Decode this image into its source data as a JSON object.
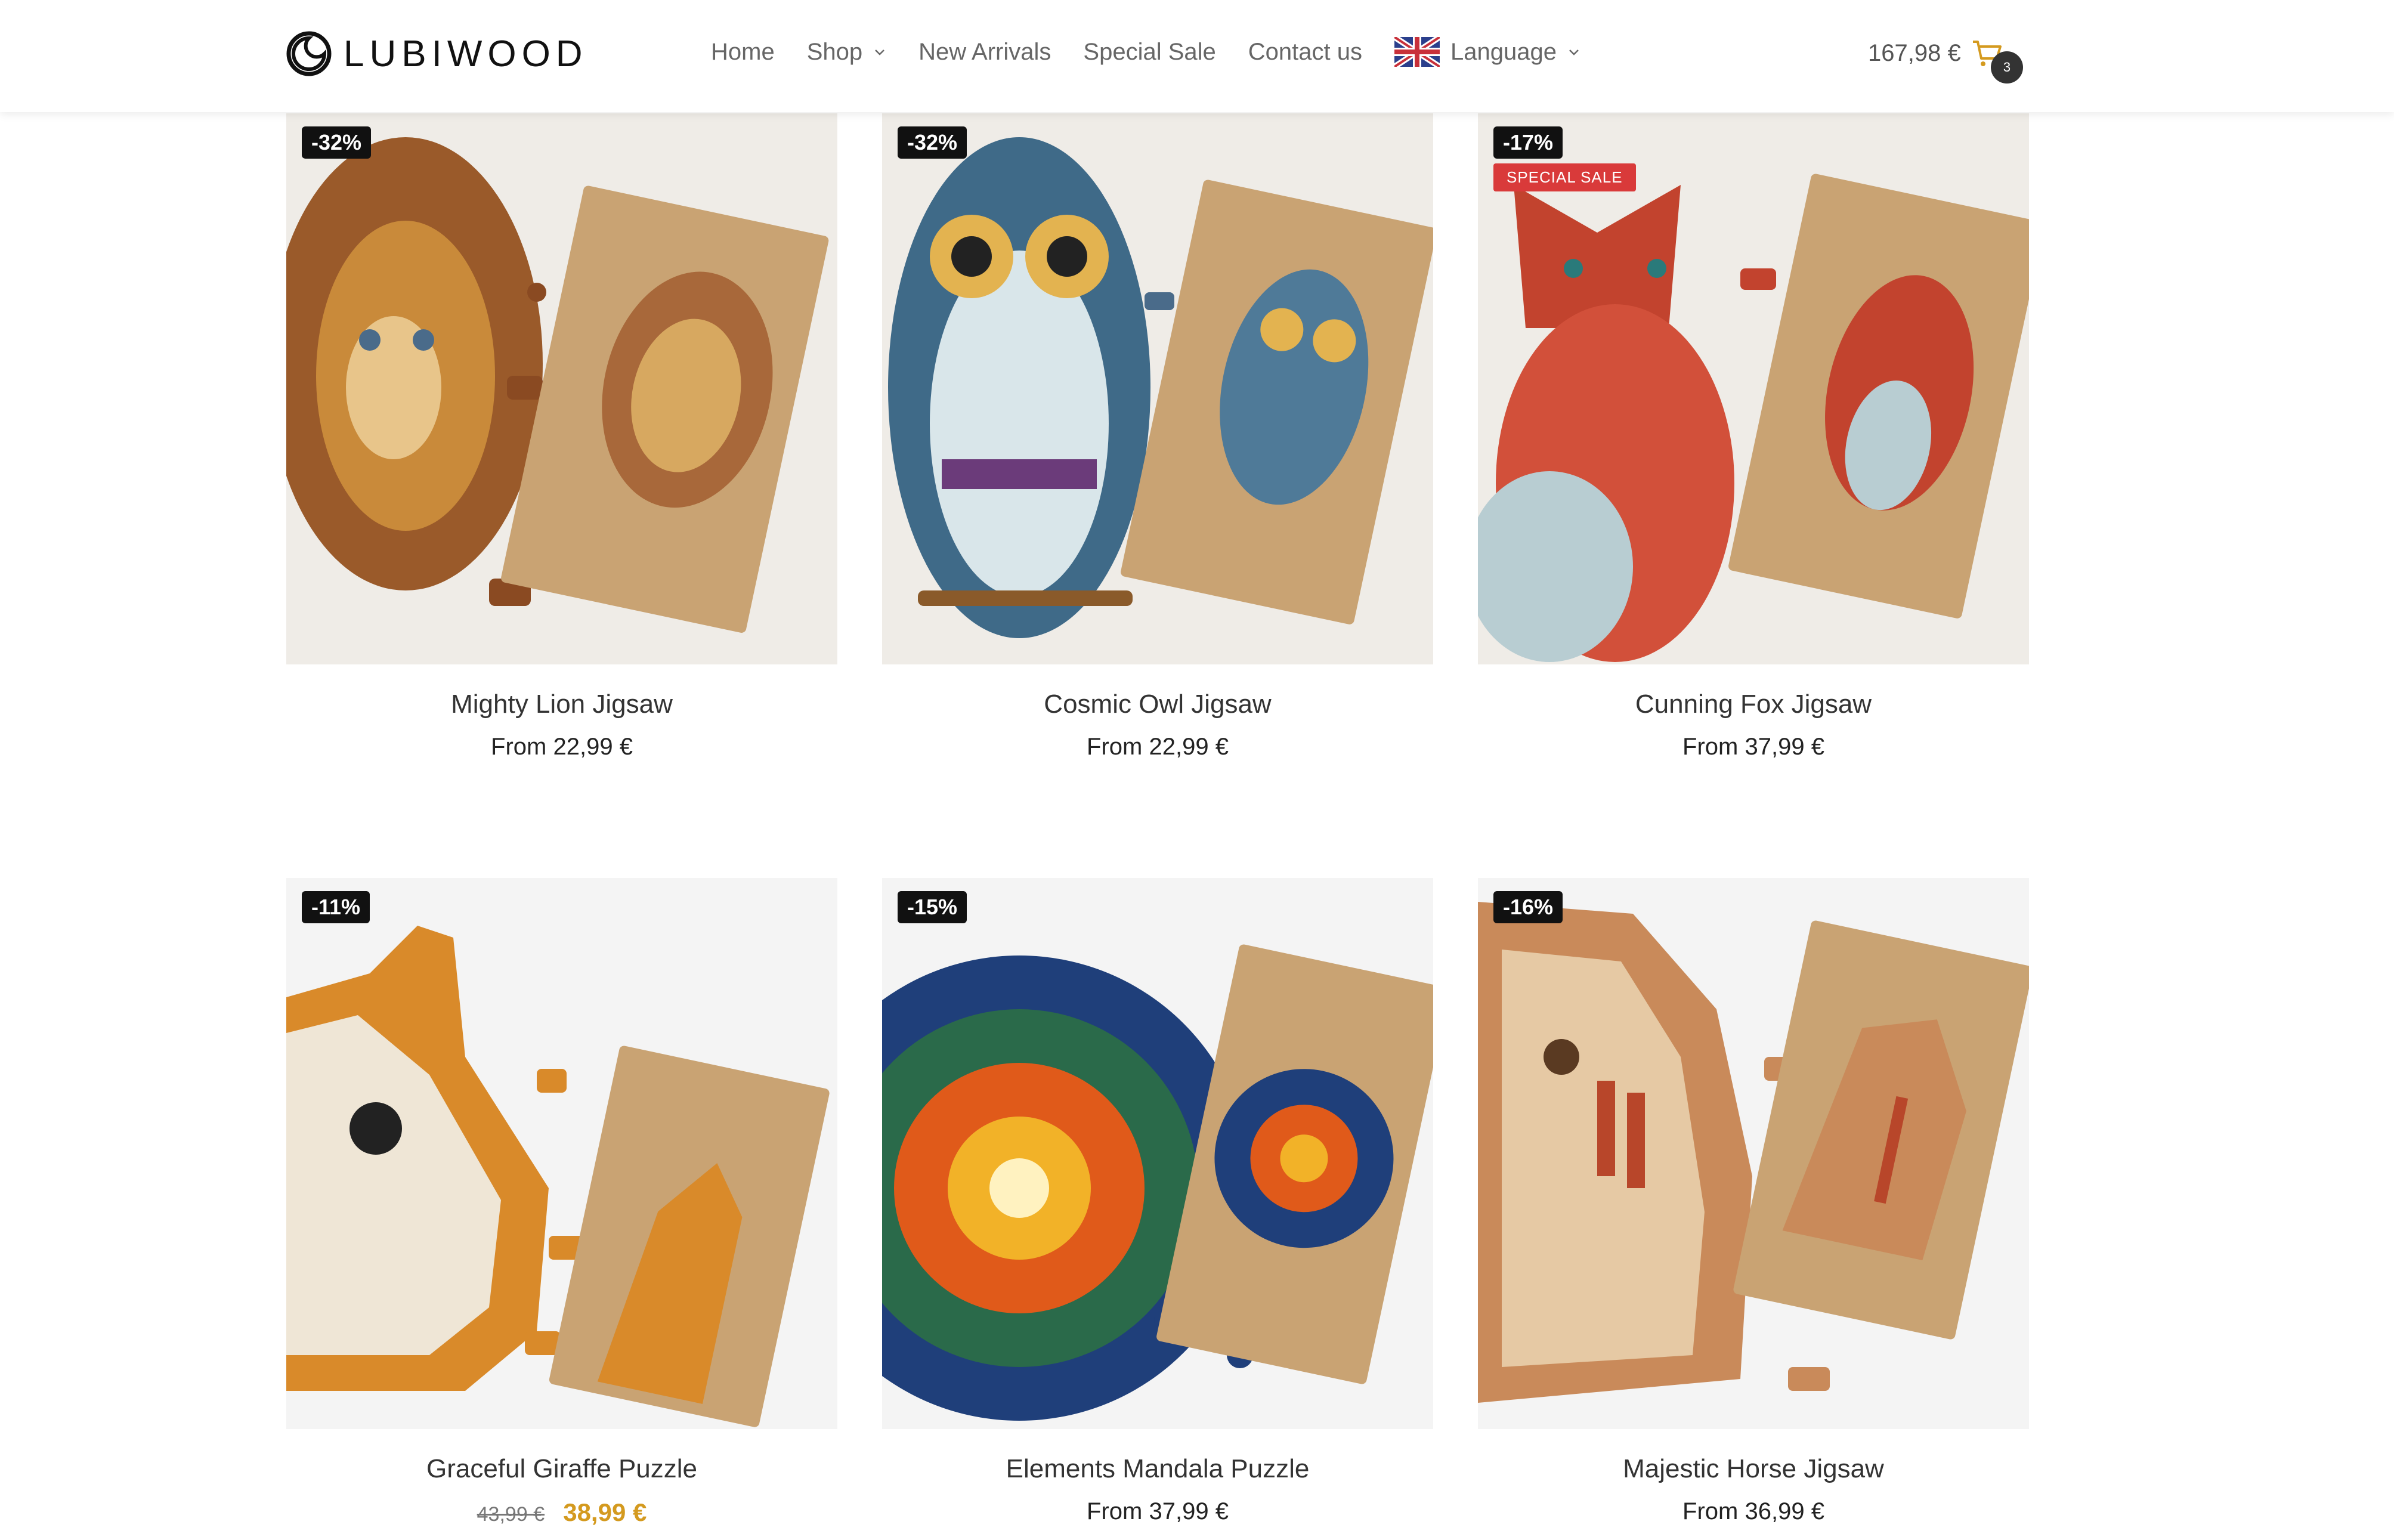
{
  "brand": {
    "name": "LUBIWOOD",
    "icon": "moon-logo-icon"
  },
  "nav": {
    "home": "Home",
    "shop": "Shop",
    "new_arrivals": "New Arrivals",
    "special_sale": "Special Sale",
    "contact": "Contact us",
    "language": "Language"
  },
  "cart": {
    "total": "167,98 €",
    "count": "3",
    "icon": "cart-icon"
  },
  "colors": {
    "accent": "#d49a1f",
    "sale": "#d93a3a",
    "badge": "#111111"
  },
  "products": [
    {
      "title": "Mighty Lion Jigsaw",
      "price": "From 22,99 €",
      "discount": "-32%"
    },
    {
      "title": "Cosmic Owl Jigsaw",
      "price": "From 22,99 €",
      "discount": "-32%"
    },
    {
      "title": "Cunning Fox Jigsaw",
      "price": "From 37,99 €",
      "discount": "-17%",
      "tag": "SPECIAL SALE"
    },
    {
      "title": "Graceful Giraffe Puzzle",
      "old_price": "43,99 €",
      "new_price": "38,99 €",
      "discount": "-11%"
    },
    {
      "title": "Elements Mandala Puzzle",
      "price": "From 37,99 €",
      "discount": "-15%"
    },
    {
      "title": "Majestic Horse Jigsaw",
      "price": "From 36,99 €",
      "discount": "-16%"
    }
  ]
}
